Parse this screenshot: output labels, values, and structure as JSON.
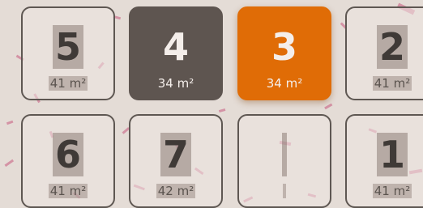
{
  "tiles": [
    {
      "number": "5",
      "area": "41 m²",
      "state": "normal"
    },
    {
      "number": "4",
      "area": "34 m²",
      "state": "selected-dark"
    },
    {
      "number": "3",
      "area": "34 m²",
      "state": "selected-accent"
    },
    {
      "number": "2",
      "area": "41 m²",
      "state": "normal"
    },
    {
      "number": "6",
      "area": "41 m²",
      "state": "normal"
    },
    {
      "number": "7",
      "area": "42 m²",
      "state": "normal"
    },
    {
      "number": "",
      "area": "",
      "state": "empty"
    },
    {
      "number": "1",
      "area": "41 m²",
      "state": "normal"
    }
  ],
  "colors": {
    "background": "#e4dcd6",
    "dark_tile": "#5e5550",
    "accent_tile": "#e06c06",
    "border": "#5e5752"
  }
}
